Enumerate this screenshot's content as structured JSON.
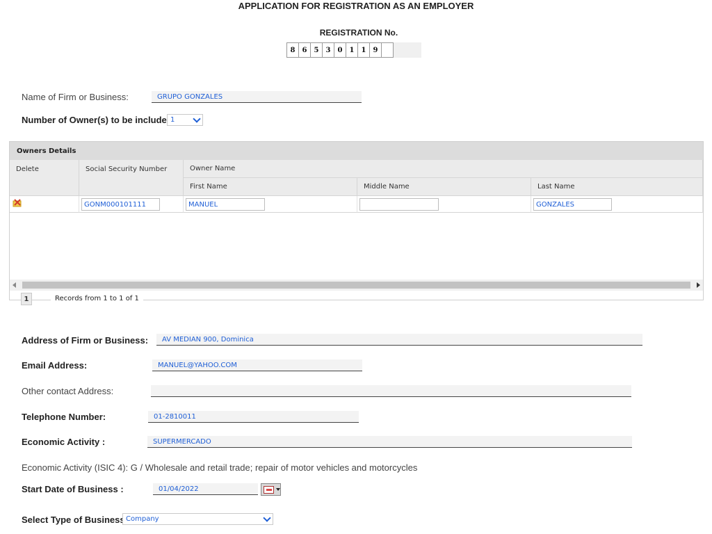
{
  "page_title": "APPLICATION FOR REGISTRATION AS AN EMPLOYER",
  "registration": {
    "label": "REGISTRATION No.",
    "digits": [
      "8",
      "6",
      "5",
      "3",
      "0",
      "1",
      "1",
      "9",
      ""
    ]
  },
  "firm_name": {
    "label": "Name of Firm or Business:",
    "value": "GRUPO GONZALES"
  },
  "owners_count": {
    "label": "Number of Owner(s) to be included:",
    "value": "1"
  },
  "owners_grid": {
    "caption": "Owners Details",
    "headers": {
      "delete": "Delete",
      "ssn": "Social Security Number",
      "owner_name": "Owner Name",
      "first": "First Name",
      "middle": "Middle Name",
      "last": "Last Name"
    },
    "rows": [
      {
        "ssn": "GONM000101111",
        "first": "MANUEL",
        "middle": "",
        "last": "GONZALES"
      }
    ],
    "pager": {
      "page": "1",
      "records_text": "Records from 1 to 1 of 1"
    }
  },
  "address": {
    "label": "Address of Firm or Business:",
    "value": "AV MEDIAN 900, Dominica"
  },
  "email": {
    "label": "Email Address:",
    "value": "MANUEL@YAHOO.COM"
  },
  "other_contact": {
    "label": "Other contact Address:",
    "value": ""
  },
  "telephone": {
    "label": "Telephone Number:",
    "value": "01-2810011"
  },
  "economic_activity": {
    "label": "Economic Activity :",
    "value": "SUPERMERCADO"
  },
  "isic_text": "Economic Activity (ISIC 4): G / Wholesale and retail trade; repair of motor vehicles and motorcycles",
  "start_date": {
    "label": "Start Date of Business :",
    "value": "01/04/2022"
  },
  "business_type": {
    "label": "Select Type of Business:",
    "value": "Company"
  },
  "icons": {
    "delete": "delete-row-icon",
    "calendar": "calendar-icon"
  }
}
